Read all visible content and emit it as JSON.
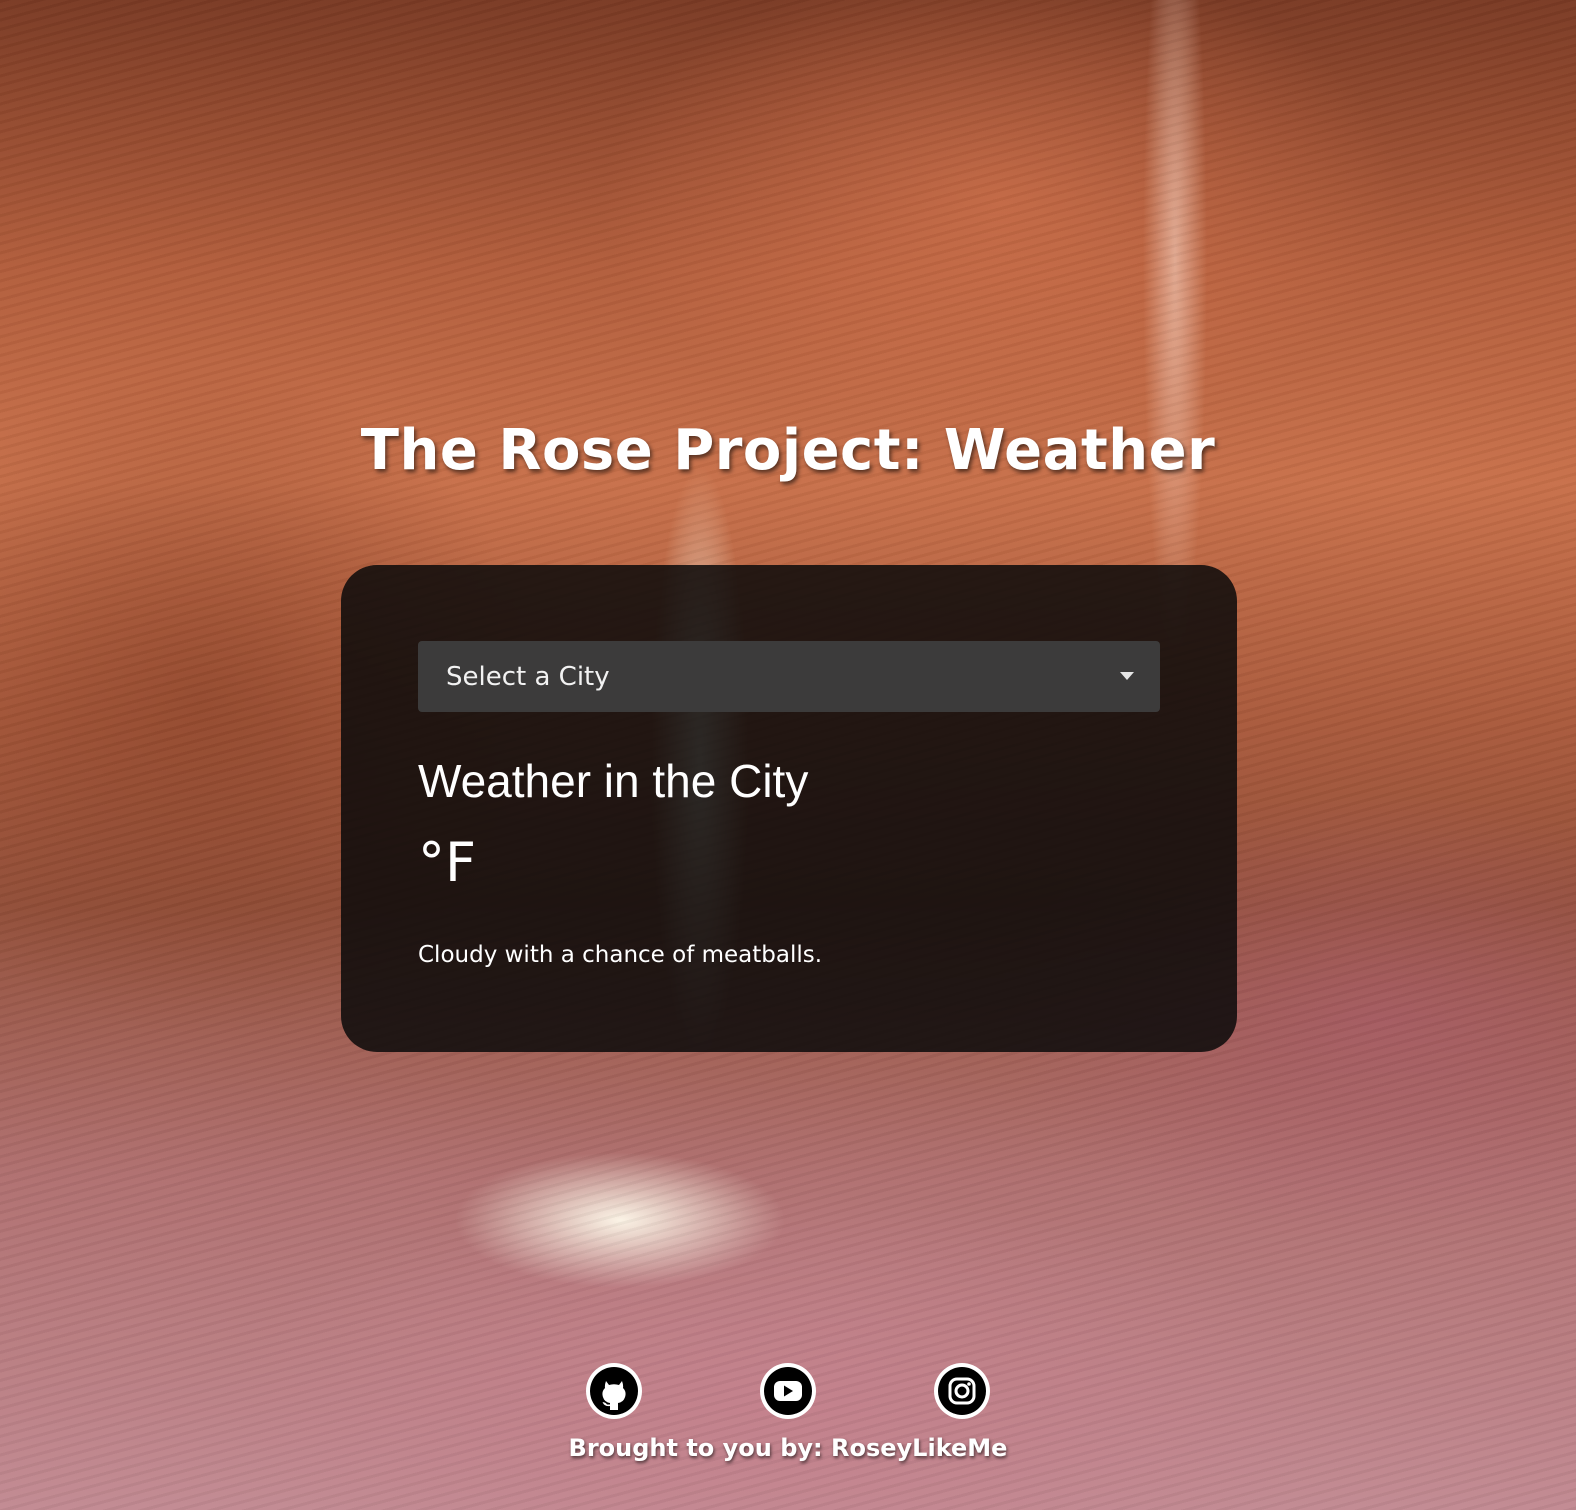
{
  "header": {
    "title": "The Rose Project: Weather"
  },
  "weather_card": {
    "city_select": {
      "selected": "Select a City"
    },
    "heading": "Weather in the City",
    "temperature": "°F",
    "description": "Cloudy with a chance of meatballs."
  },
  "footer": {
    "socials": [
      {
        "name": "github",
        "icon": "github-icon"
      },
      {
        "name": "youtube",
        "icon": "youtube-icon"
      },
      {
        "name": "instagram",
        "icon": "instagram-icon"
      }
    ],
    "credit": "Brought to you by: RoseyLikeMe"
  },
  "colors": {
    "card_background": "#0c0a0a",
    "select_background": "#3c3b3b",
    "text": "#ffffff"
  }
}
